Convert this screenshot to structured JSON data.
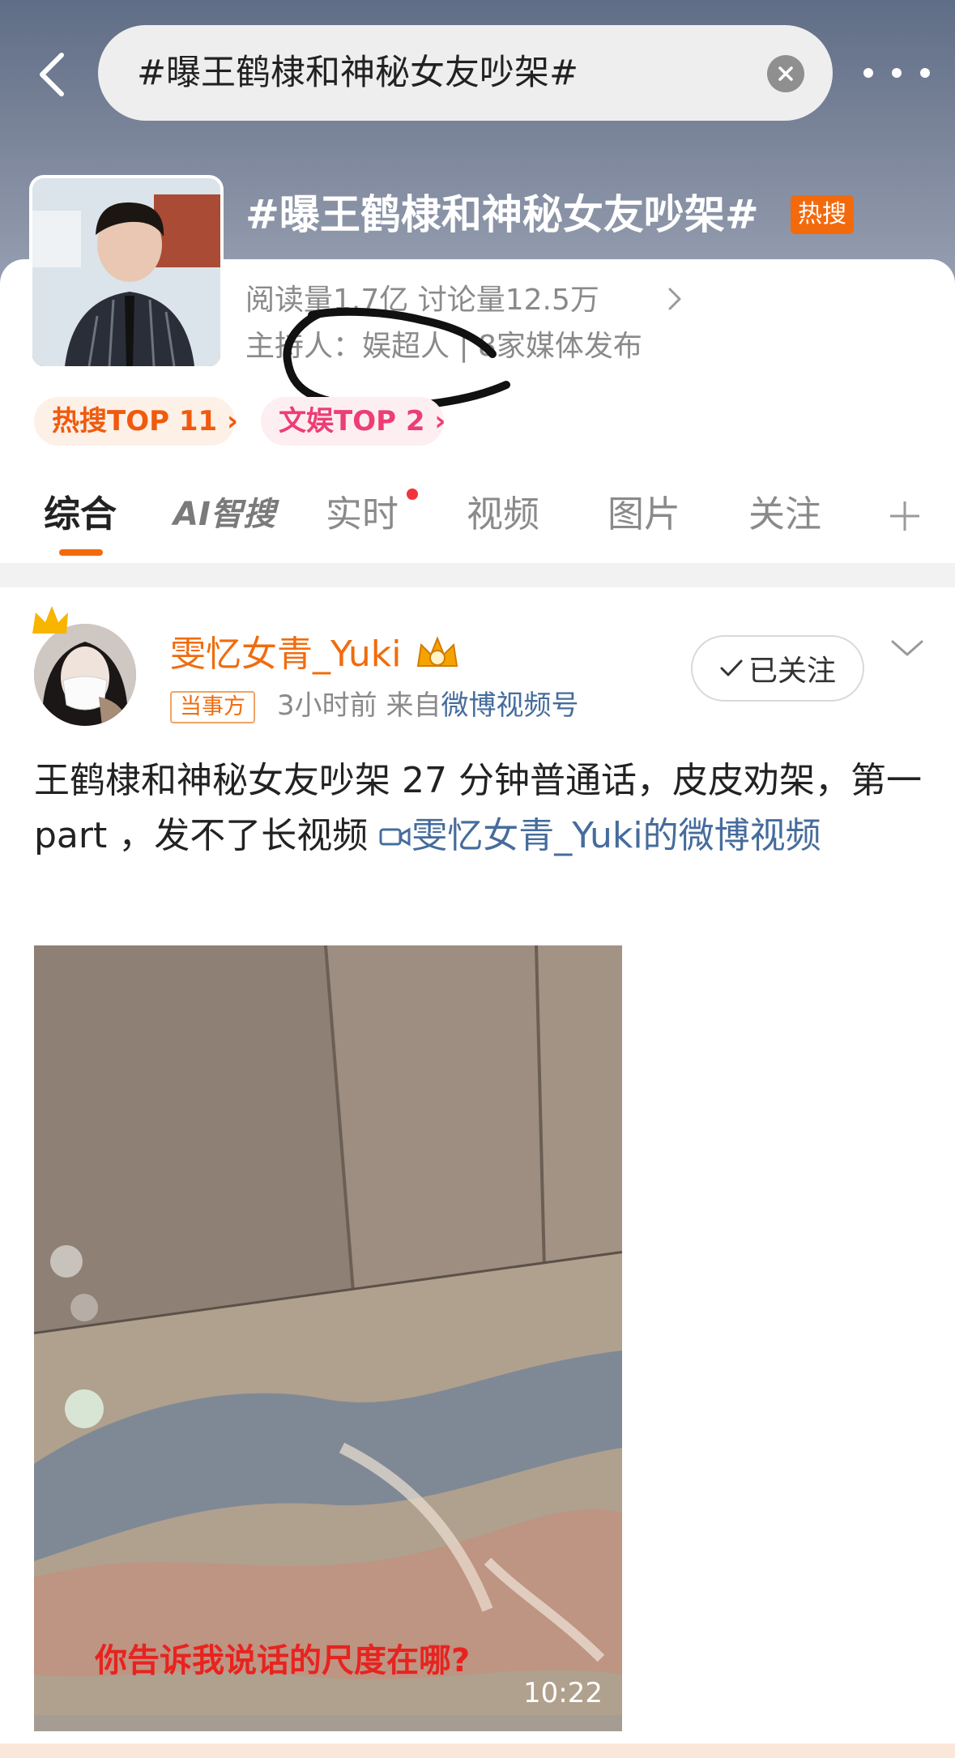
{
  "search": {
    "query": "#曝王鹤棣和神秘女友吵架#"
  },
  "topic": {
    "title": "#曝王鹤棣和神秘女友吵架#",
    "hot_tag": "热搜",
    "stats_reads": "阅读量1.7亿",
    "stats_discuss": "讨论量12.5万",
    "host": "主持人：娱超人 | 8家媒体发布",
    "pill_hot": "热搜TOP 11",
    "pill_ent": "文娱TOP 2"
  },
  "tabs": [
    {
      "label": "综合"
    },
    {
      "label": "AI智搜"
    },
    {
      "label": "实时"
    },
    {
      "label": "视频"
    },
    {
      "label": "图片"
    },
    {
      "label": "关注"
    }
  ],
  "post": {
    "username": "雯忆女青_Yuki",
    "role_tag": "当事方",
    "time": "3小时前",
    "source_prefix": "来自",
    "source": "微博视频号",
    "follow_label": "已关注",
    "text": "王鹤棣和神秘女友吵架 27 分钟普通话，皮皮劝架，第一part ，发不了长视频 ",
    "link_text": "雯忆女青_Yuki的微博视频",
    "video_subtitle": "你告诉我说话的尺度在哪?",
    "video_duration": "10:22"
  },
  "colors": {
    "accent": "#f36a0d",
    "link": "#466c9c",
    "username": "#f06c0e"
  }
}
